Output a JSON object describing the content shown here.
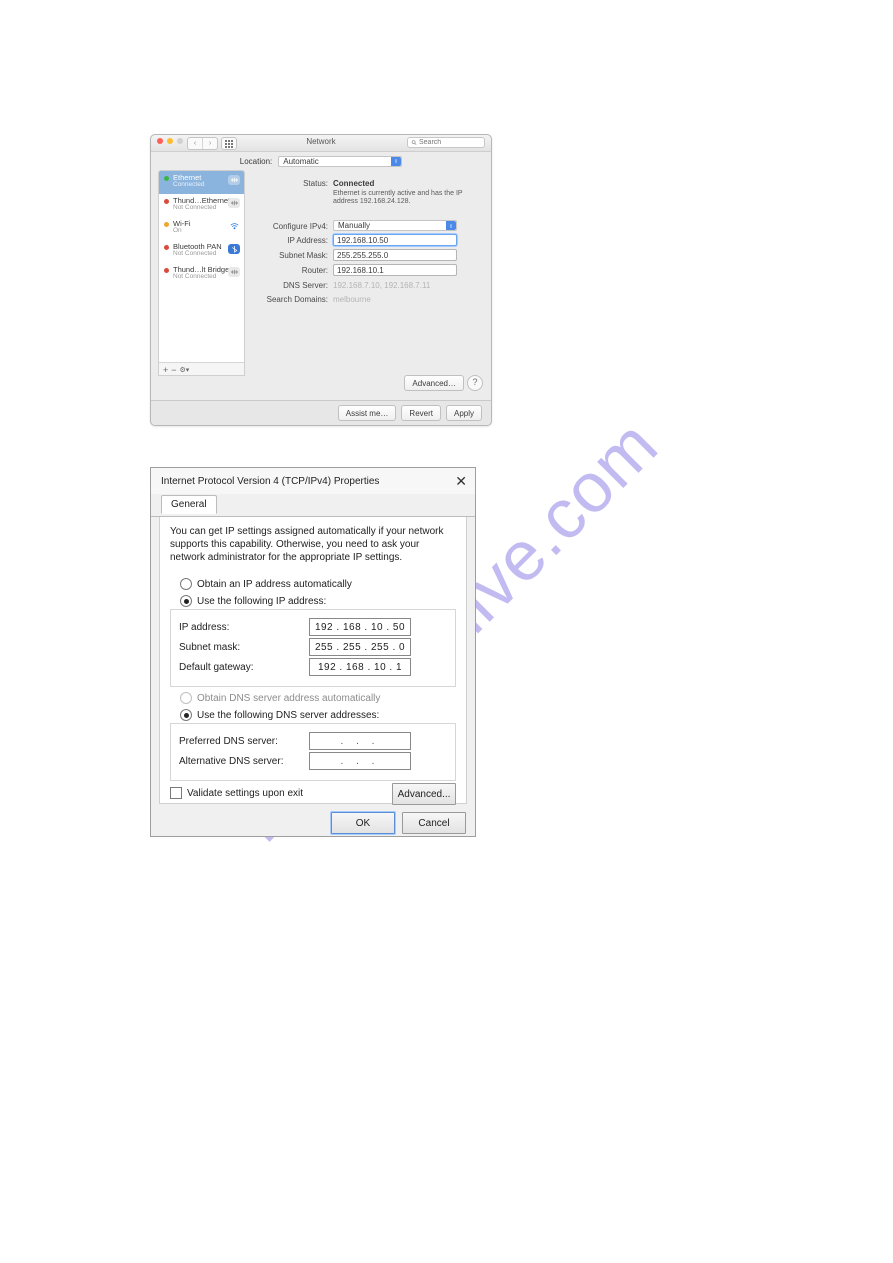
{
  "watermark": "manualshive.com",
  "mac": {
    "title": "Network",
    "search_placeholder": "Search",
    "location_label": "Location:",
    "location_value": "Automatic",
    "sidebar": [
      {
        "name": "Ethernet",
        "sub": "Connected",
        "led": "green",
        "selected": true,
        "icon": "ethernet"
      },
      {
        "name": "Thund…Ethernet",
        "sub": "Not Connected",
        "led": "red",
        "selected": false,
        "icon": "ethernet"
      },
      {
        "name": "Wi-Fi",
        "sub": "On",
        "led": "orange",
        "selected": false,
        "icon": "wifi"
      },
      {
        "name": "Bluetooth PAN",
        "sub": "Not Connected",
        "led": "red",
        "selected": false,
        "icon": "bluetooth"
      },
      {
        "name": "Thund…lt Bridge",
        "sub": "Not Connected",
        "led": "red",
        "selected": false,
        "icon": "ethernet"
      }
    ],
    "footer": {
      "plus": "+",
      "minus": "−",
      "gear": "⚙"
    },
    "fields": {
      "status_label": "Status:",
      "status_value": "Connected",
      "status_detail": "Ethernet is currently active and has the IP address 192.168.24.128.",
      "config_label": "Configure IPv4:",
      "config_value": "Manually",
      "ip_label": "IP Address:",
      "ip_value": "192.168.10.50",
      "mask_label": "Subnet Mask:",
      "mask_value": "255.255.255.0",
      "router_label": "Router:",
      "router_value": "192.168.10.1",
      "dns_label": "DNS Server:",
      "dns_value": "192.168.7.10, 192.168.7.11",
      "domains_label": "Search Domains:",
      "domains_value": "melbourne"
    },
    "buttons": {
      "advanced": "Advanced…",
      "assist": "Assist me…",
      "revert": "Revert",
      "apply": "Apply",
      "help": "?"
    }
  },
  "win": {
    "title": "Internet Protocol Version 4 (TCP/IPv4) Properties",
    "tab": "General",
    "description": "You can get IP settings assigned automatically if your network supports this capability. Otherwise, you need to ask your network administrator for the appropriate IP settings.",
    "radios": {
      "obtain_ip": "Obtain an IP address automatically",
      "use_ip": "Use the following IP address:",
      "obtain_dns": "Obtain DNS server address automatically",
      "use_dns": "Use the following DNS server addresses:"
    },
    "labels": {
      "ip": "IP address:",
      "mask": "Subnet mask:",
      "gateway": "Default gateway:",
      "pref_dns": "Preferred DNS server:",
      "alt_dns": "Alternative DNS server:"
    },
    "values": {
      "ip": "192 . 168 .  10  .  50",
      "mask": "255 . 255 . 255 .   0",
      "gateway": "192 . 168 .  10  .   1",
      "pref_dns": ".   .   .",
      "alt_dns": ".   .   ."
    },
    "validate": "Validate settings upon exit",
    "buttons": {
      "advanced": "Advanced...",
      "ok": "OK",
      "cancel": "Cancel"
    }
  }
}
